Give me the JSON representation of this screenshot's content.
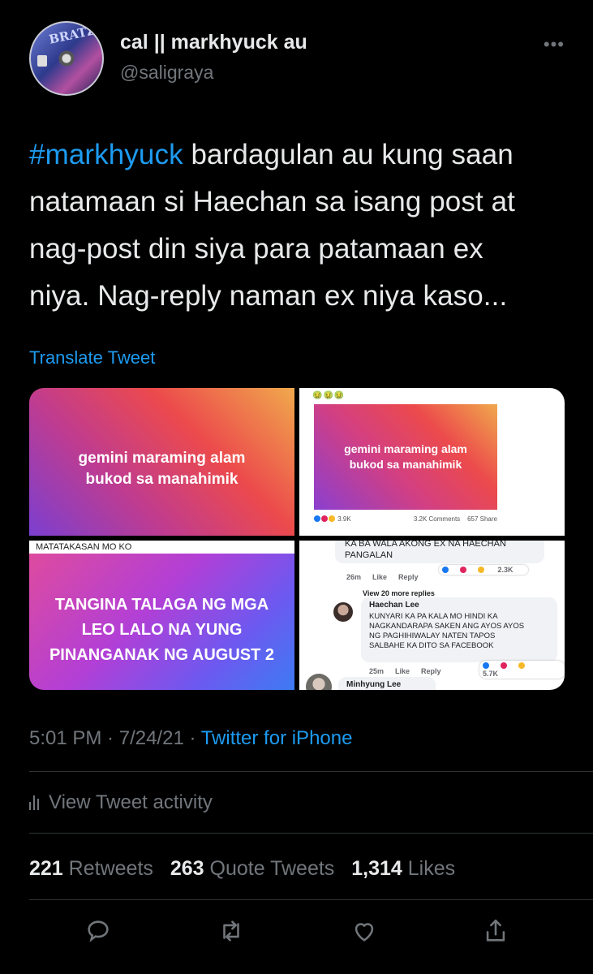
{
  "user": {
    "display_name": "cal || markhyuck au",
    "handle": "@saligraya",
    "avatar_text": "BRATZ"
  },
  "more_icon": "more-horizontal-icon",
  "tweet": {
    "hashtag": "#markhyuck",
    "text_line1_rest": " bardagulan au kung saan",
    "text_line2": "natamaan si Haechan sa isang post at",
    "text_line3": "nag-post din siya para patamaan ex",
    "text_line4": "niya. Nag-reply naman ex niya kaso..."
  },
  "translate_label": "Translate Tweet",
  "media": {
    "img1": {
      "line1": "gemini maraming alam",
      "line2": "bukod sa manahimik"
    },
    "img2": {
      "emojis": "🤢🤢🤢",
      "line1": "gemini maraming alam",
      "line2": "bukod sa manahimik",
      "reactions_count": "3.9K",
      "comments": "3.2K Comments",
      "shares": "657 Share"
    },
    "img3": {
      "top_label": "MATATAKASAN MO KO",
      "line1": "TANGINA TALAGA NG MGA",
      "line2": "LEO LALO NA YUNG",
      "line3": "PINANGANAK NG AUGUST 2"
    },
    "img4": {
      "c1_line1": "KA BA WALA AKONG EX NA HAECHAN",
      "c1_line2": "PANGALAN",
      "c1_time": "26m",
      "like": "Like",
      "reply": "Reply",
      "c1_count": "2.3K",
      "view_more": "View 20 more replies",
      "c2_name": "Haechan Lee",
      "c2_line1": "KUNYARI KA PA KALA MO HINDI KA",
      "c2_line2": "NAGKANDARAPA SAKEN ANG AYOS AYOS",
      "c2_line3": "NG PAGHIHIWALAY NATEN TAPOS",
      "c2_line4": "SALBAHE KA DITO SA FACEBOOK",
      "c2_time": "25m",
      "c2_count": "5.7K",
      "c3_name": "Minhyung Lee"
    }
  },
  "timestamp": {
    "time": "5:01 PM",
    "sep1": " · ",
    "date": "7/24/21",
    "sep2": " · ",
    "source": "Twitter for iPhone"
  },
  "activity_label": "View Tweet activity",
  "stats": {
    "retweets_count": "221",
    "retweets_label": "Retweets",
    "quotes_count": "263",
    "quotes_label": "Quote Tweets",
    "likes_count": "1,314",
    "likes_label": "Likes"
  },
  "action_icons": [
    "reply-icon",
    "retweet-icon",
    "like-icon",
    "share-icon"
  ],
  "colors": {
    "background": "#000000",
    "accent": "#1d9bf0",
    "muted": "#71767b",
    "text": "#e7e9ea"
  }
}
